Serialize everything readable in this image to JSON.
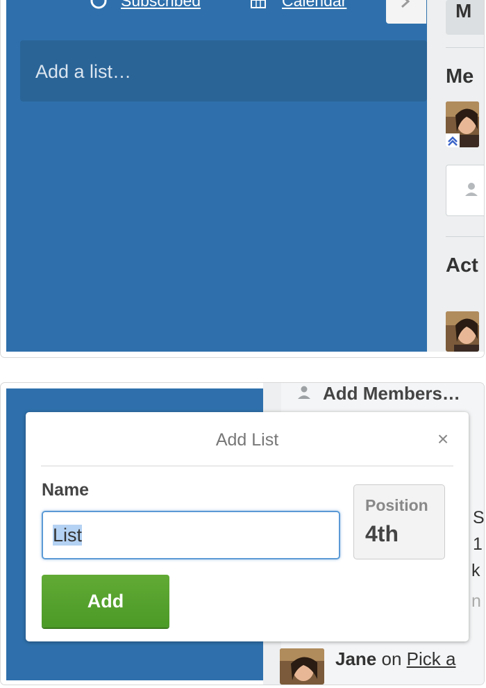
{
  "top": {
    "header": {
      "subscribed_label": "Subscribed",
      "calendar_label": "Calendar"
    },
    "board": {
      "add_list_placeholder": "Add a list…"
    },
    "sidebar": {
      "menu_label": "M",
      "members_heading": "Me",
      "activity_heading": "Act"
    }
  },
  "bottom": {
    "sidebar": {
      "add_members_label": "Add Members…",
      "activity": {
        "user": "Jane",
        "connector": "on",
        "link": "Pick a"
      }
    },
    "dialog": {
      "title": "Add List",
      "close_glyph": "×",
      "name_label": "Name",
      "name_value": "List",
      "position_label": "Position",
      "position_value": "4th",
      "add_button_label": "Add"
    }
  },
  "colors": {
    "board_blue": "#2f70ac",
    "add_list_bg": "#2a6497",
    "sidebar_bg": "#edeff0",
    "add_button_green": "#5aa52f",
    "input_focus": "#5b9ad5",
    "selection": "#b4d2f3"
  }
}
